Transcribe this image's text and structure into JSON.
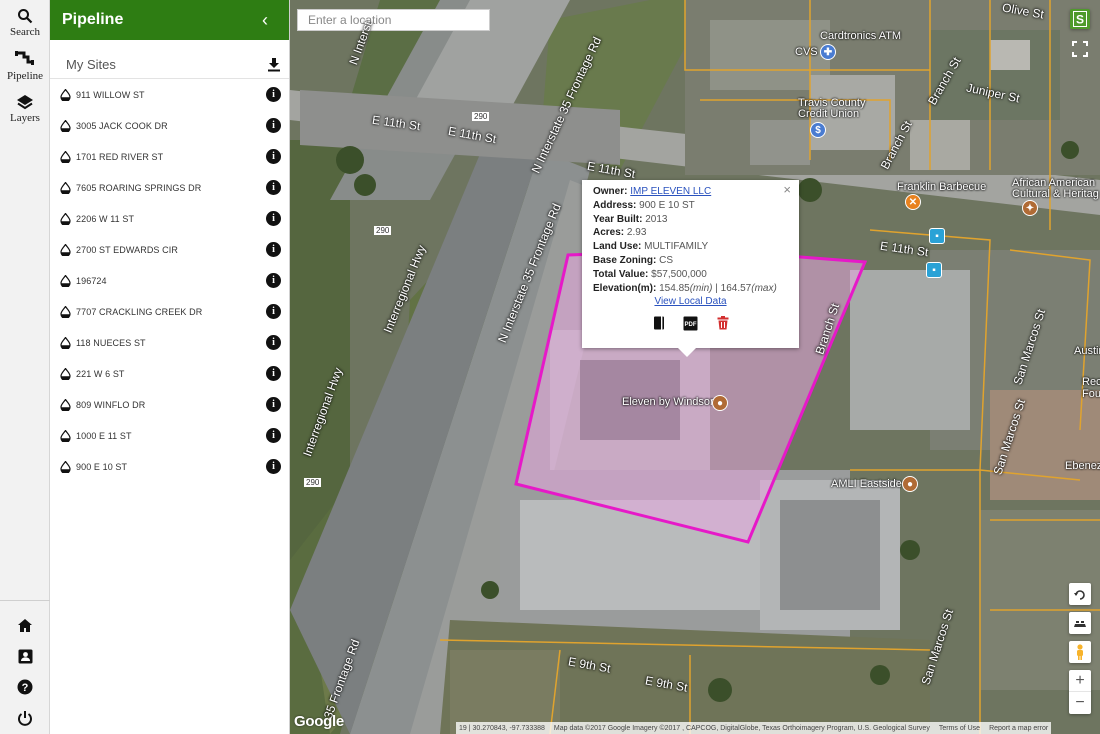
{
  "nav": {
    "search_label": "Search",
    "pipeline_label": "Pipeline",
    "layers_label": "Layers"
  },
  "panel": {
    "title": "Pipeline",
    "collapse_glyph": "‹",
    "sites_title": "My Sites",
    "sites": [
      "911 WILLOW ST",
      "3005 JACK COOK DR",
      "1701 RED RIVER ST",
      "7605 ROARING SPRINGS DR",
      "2206 W 11 ST",
      "2700 ST EDWARDS CIR",
      "196724",
      "7707 CRACKLING CREEK DR",
      "118 NUECES ST",
      "221 W 6 ST",
      "809 WINFLO DR",
      "1000 E 11 ST",
      "900 E 10 ST"
    ],
    "info_glyph": "i"
  },
  "map": {
    "search_placeholder": "Enter a location",
    "labels": {
      "e11_a": "E 11th St",
      "e11_b": "E 11th St",
      "e11_c": "E 11th St",
      "e11_d": "E 11th St",
      "e9_a": "E 9th St",
      "e9_b": "E 9th St",
      "i35_a": "N Interstate 35 Frontage Rd",
      "i35_b": "N Interstate 35 Frontage Rd",
      "n_interst": "N Interst",
      "interregional_a": "Interregional Hwy",
      "interregional_b": "Interregional Hwy",
      "frontage_35": "35 Frontage Rd",
      "branch_a": "Branch St",
      "branch_b": "Branch St",
      "branch_c": "Branch St",
      "juniper": "Juniper St",
      "olive": "Olive St",
      "sanmarcos_a": "San Marcos St",
      "sanmarcos_b": "San Marcos St",
      "sanmarcos_c": "San Marcos St",
      "cardtronics": "Cardtronics ATM",
      "cvs": "CVS",
      "travis_cu": "Travis County Credit Union",
      "franklin": "Franklin Barbecue",
      "african_american": "African American Cultural & Heritag",
      "eleven_windsor": "Eleven by Windsor",
      "amli": "AMLI Eastside",
      "ebenez": "Ebenez",
      "austin": "Austin",
      "rec_fou": "Rec Fou",
      "hwy_290_a": "290",
      "hwy_290_b": "290",
      "hwy_290_c": "290"
    },
    "attribution": {
      "coords": "19 | 30.270843, -97.733388",
      "mapdata": "Map data ©2017 Google Imagery ©2017 , CAPCOG, DigitalGlobe, Texas Orthoimagery Program, U.S. Geological Survey",
      "terms": "Terms of Use",
      "report": "Report a map error"
    },
    "google_logo": "Google",
    "zoom_in": "+",
    "zoom_out": "−"
  },
  "popup": {
    "owner_label": "Owner:",
    "owner_value": "IMP ELEVEN LLC",
    "address_label": "Address:",
    "address_value": "900 E 10 ST",
    "year_label": "Year Built:",
    "year_value": "2013",
    "acres_label": "Acres:",
    "acres_value": "2.93",
    "landuse_label": "Land Use:",
    "landuse_value": "MULTIFAMILY",
    "zoning_label": "Base Zoning:",
    "zoning_value": "CS",
    "total_label": "Total Value:",
    "total_value": "$57,500,000",
    "elev_label": "Elevation(m):",
    "elev_min": "154.85",
    "elev_min_unit": "(min)",
    "elev_sep": " | ",
    "elev_max": "164.57",
    "elev_max_unit": "(max)",
    "link": "View Local Data",
    "close_glyph": "×"
  },
  "colors": {
    "header_green": "#2e7d13",
    "parcel_outline": "#e619c8",
    "parcel_fill": "#e8a8e0",
    "lot_lines": "#e0a32e"
  }
}
